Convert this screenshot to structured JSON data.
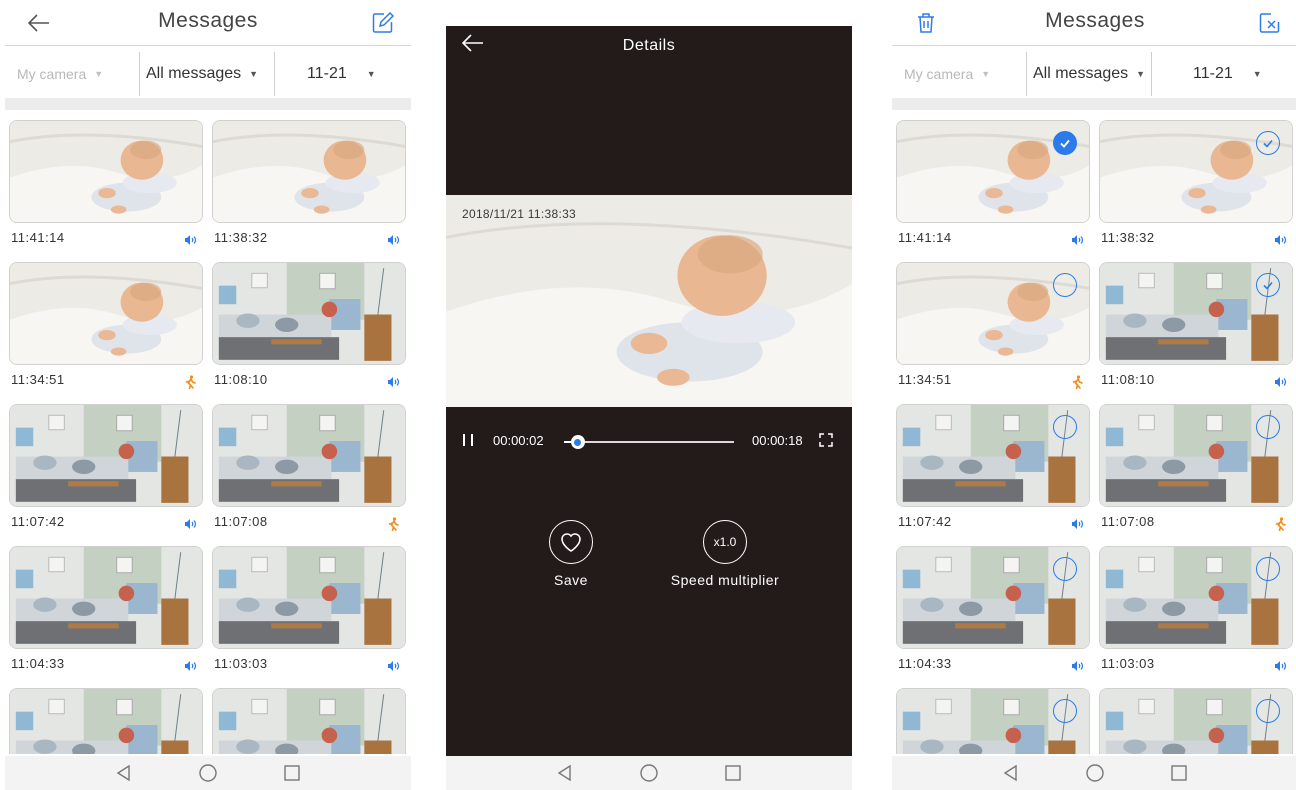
{
  "colors": {
    "accent": "#2b7bea",
    "motion": "#f08c1e",
    "dark_bg": "#231b19"
  },
  "left": {
    "title": "Messages",
    "filters": {
      "camera": "My camera",
      "type": "All messages",
      "date": "11-21"
    },
    "items": [
      {
        "time": "11:41:14",
        "event": "sound-icon",
        "scene": "baby"
      },
      {
        "time": "11:38:32",
        "event": "sound-icon",
        "scene": "baby"
      },
      {
        "time": "11:34:51",
        "event": "motion-icon",
        "scene": "baby"
      },
      {
        "time": "11:08:10",
        "event": "sound-icon",
        "scene": "room"
      },
      {
        "time": "11:07:42",
        "event": "sound-icon",
        "scene": "room"
      },
      {
        "time": "11:07:08",
        "event": "motion-icon",
        "scene": "room"
      },
      {
        "time": "11:04:33",
        "event": "sound-icon",
        "scene": "room"
      },
      {
        "time": "11:03:03",
        "event": "sound-icon",
        "scene": "room"
      },
      {
        "time": "",
        "event": "",
        "scene": "room"
      },
      {
        "time": "",
        "event": "",
        "scene": "room"
      }
    ]
  },
  "details": {
    "title": "Details",
    "timestamp": "2018/11/21 11:38:33",
    "current_time": "00:00:02",
    "total_time": "00:00:18",
    "progress": 0.08,
    "save_label": "Save",
    "speed_value": "x1.0",
    "speed_label": "Speed multiplier"
  },
  "right": {
    "title": "Messages",
    "filters": {
      "camera": "My camera",
      "type": "All messages",
      "date": "11-21"
    },
    "selection": [
      "filled",
      "check",
      "empty",
      "check",
      "empty",
      "empty",
      "empty",
      "empty",
      "empty",
      "empty"
    ]
  }
}
